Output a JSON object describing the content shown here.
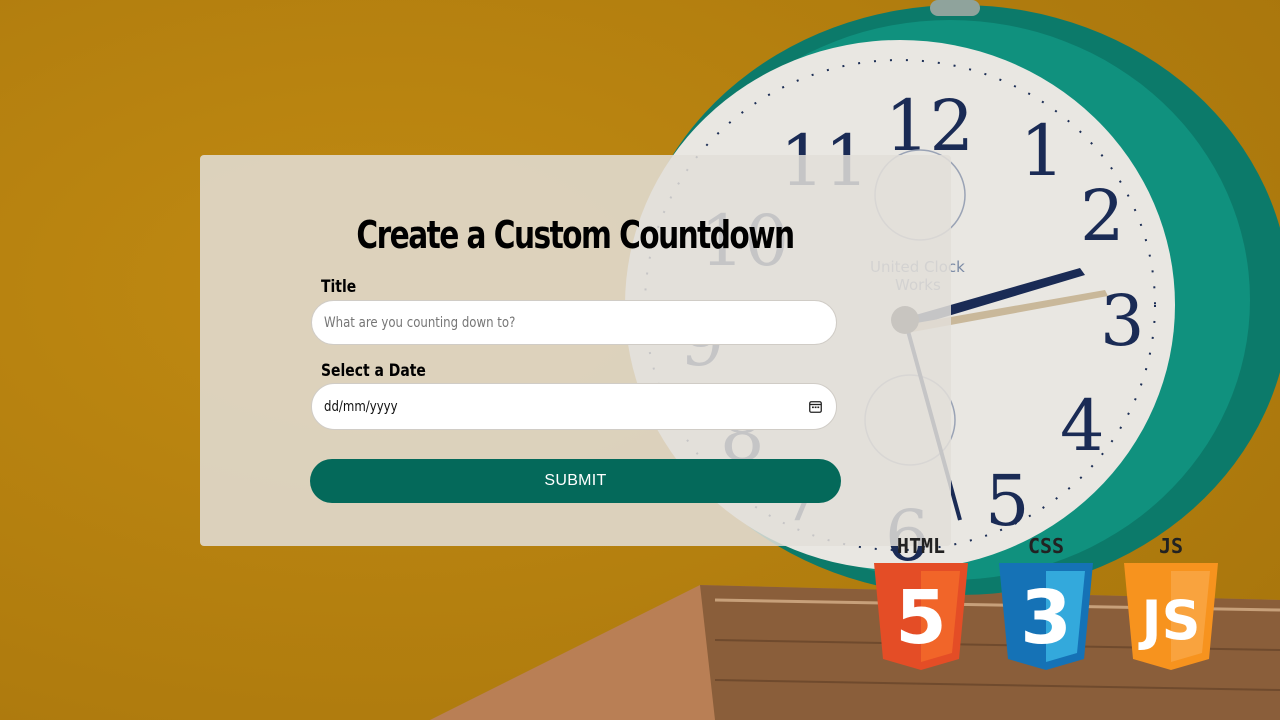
{
  "form": {
    "heading": "Create a Custom Countdown",
    "title_label": "Title",
    "title_placeholder": "What are you counting down to?",
    "date_label": "Select a Date",
    "date_value": "dd/mm/yyyy",
    "submit_label": "SUBMIT"
  },
  "logos": [
    {
      "name": "HTML",
      "number": "5",
      "color": "#e44d26"
    },
    {
      "name": "CSS",
      "number": "3",
      "color": "#1572b6"
    },
    {
      "name": "JS",
      "number": "JS",
      "color": "#f7931e"
    }
  ],
  "background": {
    "clock_numbers": [
      "12",
      "1",
      "2",
      "3",
      "4",
      "5",
      "6",
      "7",
      "8",
      "9",
      "10",
      "11"
    ],
    "clock_brand": "United Clock Works",
    "accent_color": "#04695a"
  },
  "icons": [
    "calendar-icon",
    "html5-icon",
    "css3-icon",
    "js-icon"
  ]
}
